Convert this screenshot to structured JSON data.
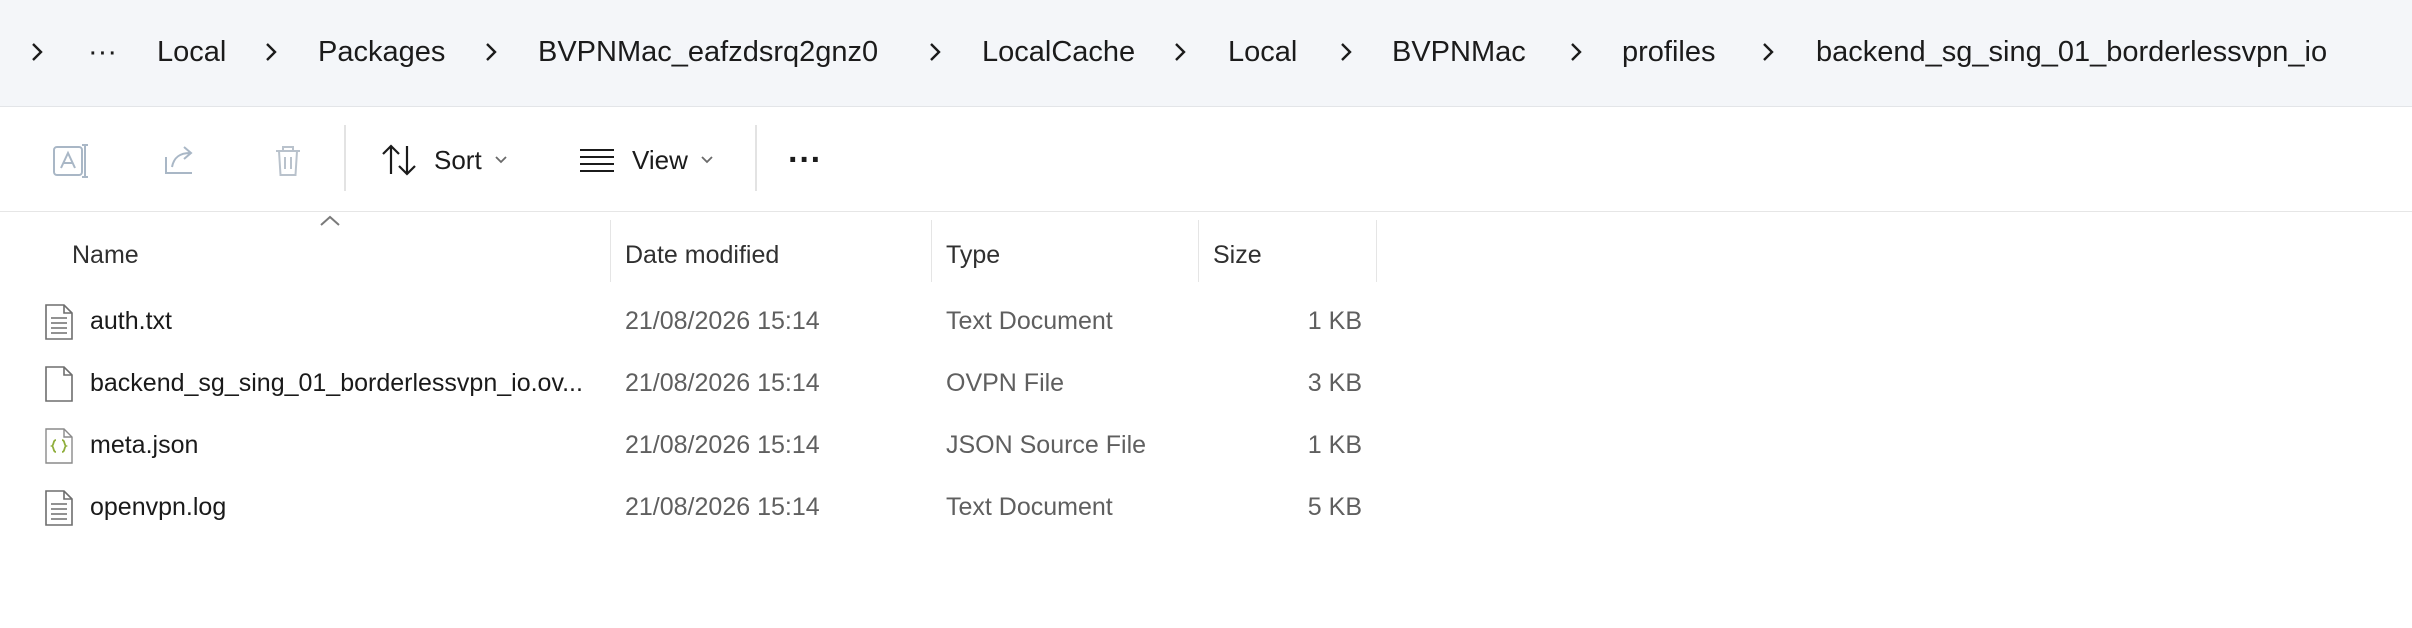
{
  "breadcrumb": {
    "overflow": "···",
    "segments": [
      "Local",
      "Packages",
      "BVPNMac_eafzdsrq2gnz0",
      "LocalCache",
      "Local",
      "BVPNMac",
      "profiles",
      "backend_sg_sing_01_borderlessvpn_io"
    ]
  },
  "toolbar": {
    "icons": [
      "rename-icon",
      "share-icon",
      "delete-icon"
    ],
    "sort_label": "Sort",
    "view_label": "View",
    "more_label": "···"
  },
  "columns": [
    "Name",
    "Date modified",
    "Type",
    "Size"
  ],
  "files": [
    {
      "name": "auth.txt",
      "date": "21/08/2026 15:14",
      "type": "Text Document",
      "size": "1 KB",
      "icon": "text-file-icon"
    },
    {
      "name": "backend_sg_sing_01_borderlessvpn_io.ov...",
      "date": "21/08/2026 15:14",
      "type": "OVPN File",
      "size": "3 KB",
      "icon": "generic-file-icon"
    },
    {
      "name": "meta.json",
      "date": "21/08/2026 15:14",
      "type": "JSON Source File",
      "size": "1 KB",
      "icon": "json-file-icon"
    },
    {
      "name": "openvpn.log",
      "date": "21/08/2026 15:14",
      "type": "Text Document",
      "size": "5 KB",
      "icon": "text-file-icon"
    }
  ],
  "colors": {
    "accent": "#0067c0",
    "icon_gray": "#9aa8b8",
    "text_secondary": "#5f5f5f"
  }
}
